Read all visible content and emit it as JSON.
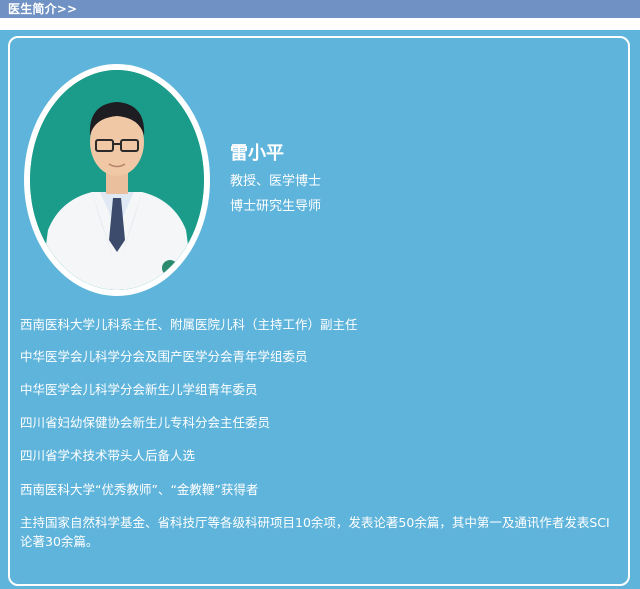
{
  "header": {
    "title": "医生简介>>"
  },
  "doctor": {
    "name": "雷小平",
    "titles": [
      "教授、医学博士",
      "博士研究生导师"
    ],
    "photo_icon": "doctor-portrait"
  },
  "duties": [
    "西南医科大学儿科系主任、附属医院儿科（主持工作）副主任",
    "中华医学会儿科学分会及围产医学分会青年学组委员",
    "中华医学会儿科学分会新生儿学组青年委员",
    "四川省妇幼保健协会新生儿专科分会主任委员",
    "四川省学术技术带头人后备人选",
    "西南医科大学“优秀教师”、“金教鞭”获得者",
    "主持国家自然科学基金、省科技厅等各级科研项目10余项，发表论著50余篇，其中第一及通讯作者发表SCI论著30余篇。"
  ],
  "colors": {
    "header": "#6f91c4",
    "panel": "#5fb4db",
    "photo_bg": "#1b9c8a",
    "text": "#ffffff"
  }
}
